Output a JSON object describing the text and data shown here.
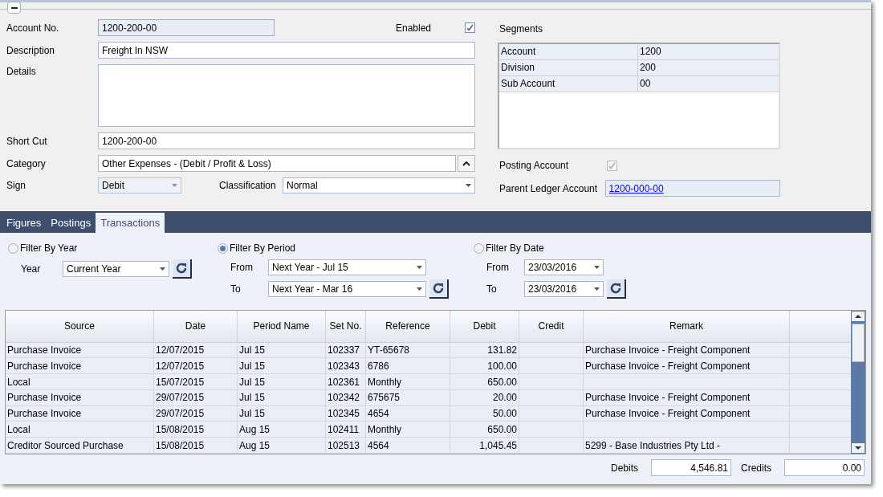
{
  "form": {
    "account_no": {
      "label": "Account No.",
      "value": "1200-200-00"
    },
    "enabled": {
      "label": "Enabled",
      "checked": true
    },
    "description": {
      "label": "Description",
      "value": "Freight In NSW"
    },
    "details": {
      "label": "Details"
    },
    "short_cut": {
      "label": "Short Cut",
      "value": "1200-200-00"
    },
    "category": {
      "label": "Category",
      "value": "Other Expenses - (Debit / Profit & Loss)"
    },
    "sign": {
      "label": "Sign",
      "value": "Debit",
      "disabled": true
    },
    "classification": {
      "label": "Classification",
      "value": "Normal"
    }
  },
  "segments": {
    "label": "Segments",
    "rows": [
      {
        "name": "Account",
        "value": "1200"
      },
      {
        "name": "Division",
        "value": "200"
      },
      {
        "name": "Sub Account",
        "value": "00"
      }
    ]
  },
  "posting_account": {
    "label": "Posting Account",
    "checked": true,
    "disabled": true
  },
  "parent_ledger": {
    "label": "Parent Ledger Account",
    "value": "1200-000-00"
  },
  "tabs": [
    {
      "label": "Figures",
      "selected": false
    },
    {
      "label": "Postings",
      "selected": false
    },
    {
      "label": "Transactions",
      "selected": true
    }
  ],
  "filters": [
    {
      "label": "Filter By Year",
      "selected": false,
      "fields": [
        {
          "label": "Year",
          "value": "Current Year"
        }
      ]
    },
    {
      "label": "Filter By Period",
      "selected": true,
      "fields": [
        {
          "label": "From",
          "value": "Next Year - Jul 15"
        },
        {
          "label": "To",
          "value": "Next Year - Mar 16"
        }
      ]
    },
    {
      "label": "Filter By Date",
      "selected": false,
      "fields": [
        {
          "label": "From",
          "value": "23/03/2016"
        },
        {
          "label": "To",
          "value": "23/03/2016"
        }
      ]
    }
  ],
  "table": {
    "columns": [
      {
        "label": "Source",
        "kind": "text"
      },
      {
        "label": "Date",
        "kind": "text"
      },
      {
        "label": "Period Name",
        "kind": "text"
      },
      {
        "label": "Set No.",
        "kind": "text"
      },
      {
        "label": "Reference",
        "kind": "text"
      },
      {
        "label": "Debit",
        "kind": "number"
      },
      {
        "label": "Credit",
        "kind": "number"
      },
      {
        "label": "Remark",
        "kind": "text"
      }
    ],
    "rows": [
      [
        "Purchase Invoice",
        "12/07/2015",
        "Jul 15",
        "102337",
        "YT-65678",
        "131.82",
        "",
        "Purchase Invoice - Freight Component"
      ],
      [
        "Purchase Invoice",
        "12/07/2015",
        "Jul 15",
        "102343",
        "6786",
        "100.00",
        "",
        "Purchase Invoice - Freight Component"
      ],
      [
        "Local",
        "15/07/2015",
        "Jul 15",
        "102361",
        "Monthly",
        "650.00",
        "",
        ""
      ],
      [
        "Purchase Invoice",
        "29/07/2015",
        "Jul 15",
        "102342",
        "675675",
        "20.00",
        "",
        "Purchase Invoice - Freight Component"
      ],
      [
        "Purchase Invoice",
        "29/07/2015",
        "Jul 15",
        "102345",
        "4654",
        "50.00",
        "",
        "Purchase Invoice - Freight Component"
      ],
      [
        "Local",
        "15/08/2015",
        "Aug 15",
        "102411",
        "Monthly",
        "650.00",
        "",
        ""
      ],
      [
        "Creditor Sourced Purchase",
        "15/08/2015",
        "Aug 15",
        "102513",
        "4564",
        "1,045.45",
        "",
        "5299 - Base Industries Pty Ltd -"
      ]
    ]
  },
  "totals": [
    {
      "label": "Debits",
      "value": "4,546.81"
    },
    {
      "label": "Credits",
      "value": "0.00"
    }
  ]
}
